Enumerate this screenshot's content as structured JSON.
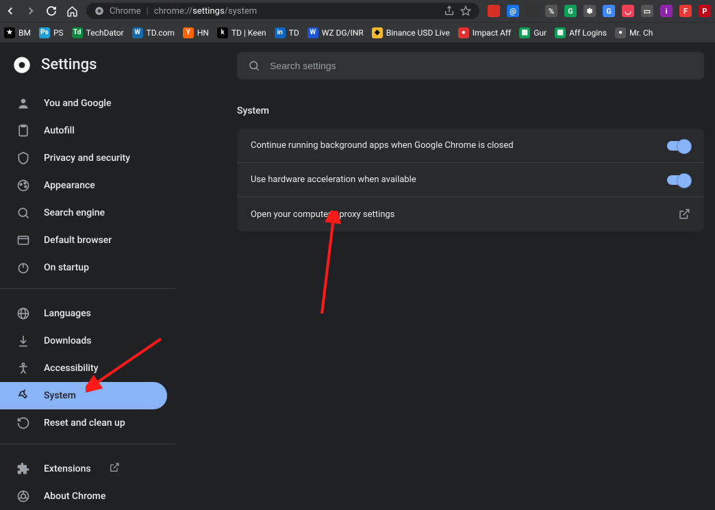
{
  "url": {
    "prefix": "Chrome",
    "path_dim": "chrome://",
    "path_bold": "settings",
    "path_tail": "/system"
  },
  "bookmarks": [
    {
      "label": "BM",
      "color": "#fff",
      "bg": "#000",
      "text": "★"
    },
    {
      "label": "PS",
      "color": "#fff",
      "bg": "#1e9fd8",
      "text": "Ps"
    },
    {
      "label": "TechDator",
      "color": "#fff",
      "bg": "#0a8a3e",
      "text": "Td"
    },
    {
      "label": "TD.com",
      "color": "#fff",
      "bg": "#1769aa",
      "text": "W"
    },
    {
      "label": "HN",
      "color": "#fff",
      "bg": "#ff6600",
      "text": "Y"
    },
    {
      "label": "TD | Keen",
      "color": "#fff",
      "bg": "#000",
      "text": "k"
    },
    {
      "label": "TD",
      "color": "#fff",
      "bg": "#0a66c2",
      "text": "in"
    },
    {
      "label": "WZ DG/INR",
      "color": "#fff",
      "bg": "#1e56d4",
      "text": "W"
    },
    {
      "label": "Binance USD Live",
      "color": "#000",
      "bg": "#f3ba2f",
      "text": "◆"
    },
    {
      "label": "Impact Aff",
      "color": "#fff",
      "bg": "#e03131",
      "text": "●"
    },
    {
      "label": "Gur",
      "color": "#fff",
      "bg": "#0f9d58",
      "text": "▦"
    },
    {
      "label": "Aff Logins",
      "color": "#fff",
      "bg": "#0f9d58",
      "text": "▦"
    },
    {
      "label": "Mr. Ch",
      "color": "#fff",
      "bg": "#555",
      "text": "●"
    }
  ],
  "ext_icons": [
    {
      "bg": "#d93025",
      "txt": ""
    },
    {
      "bg": "#1a73e8",
      "txt": "@"
    },
    {
      "bg": "#333",
      "txt": ""
    },
    {
      "bg": "#555",
      "txt": "%"
    },
    {
      "bg": "#0f9d58",
      "txt": "G"
    },
    {
      "bg": "#555",
      "txt": "✽"
    },
    {
      "bg": "#4285f4",
      "txt": "G"
    },
    {
      "bg": "#ef4056",
      "txt": "◡"
    },
    {
      "bg": "#555",
      "txt": "▭"
    },
    {
      "bg": "#8e24aa",
      "txt": "i"
    },
    {
      "bg": "#e53935",
      "txt": "F"
    },
    {
      "bg": "#bd081c",
      "txt": "P"
    }
  ],
  "header": {
    "title": "Settings"
  },
  "search": {
    "placeholder": "Search settings"
  },
  "nav": [
    {
      "label": "You and Google"
    },
    {
      "label": "Autofill"
    },
    {
      "label": "Privacy and security"
    },
    {
      "label": "Appearance"
    },
    {
      "label": "Search engine"
    },
    {
      "label": "Default browser"
    },
    {
      "label": "On startup"
    }
  ],
  "nav2": [
    {
      "label": "Languages"
    },
    {
      "label": "Downloads"
    },
    {
      "label": "Accessibility"
    },
    {
      "label": "System"
    },
    {
      "label": "Reset and clean up"
    }
  ],
  "nav3": [
    {
      "label": "Extensions"
    },
    {
      "label": "About Chrome"
    }
  ],
  "section": {
    "title": "System"
  },
  "rows": {
    "r1": "Continue running background apps when Google Chrome is closed",
    "r2": "Use hardware acceleration when available",
    "r3": "Open your computer's proxy settings"
  }
}
